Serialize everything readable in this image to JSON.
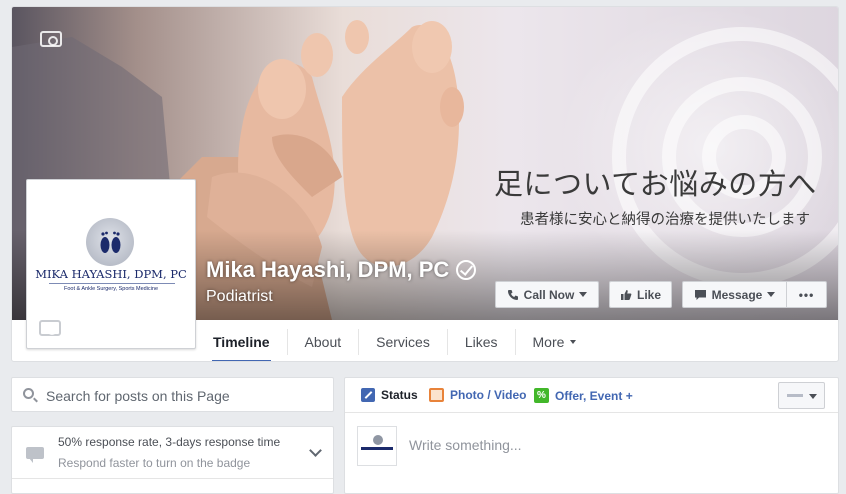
{
  "page": {
    "name": "Mika Hayashi, DPM, PC",
    "category": "Podiatrist",
    "verified": true
  },
  "cover": {
    "headline_jp": "足についてお悩みの方へ",
    "subline_jp": "患者様に安心と納得の治療を提供いたします"
  },
  "profile_logo": {
    "name": "MIKA HAYASHI, DPM, PC",
    "tagline": "Foot & Ankle Surgery, Sports Medicine"
  },
  "actions": {
    "call_now": "Call Now",
    "like": "Like",
    "message": "Message",
    "more": "•••"
  },
  "tabs": [
    {
      "label": "Timeline",
      "active": true
    },
    {
      "label": "About"
    },
    {
      "label": "Services"
    },
    {
      "label": "Likes"
    },
    {
      "label": "More"
    }
  ],
  "search": {
    "placeholder": "Search for posts on this Page"
  },
  "response": {
    "title": "50% response rate, 3-days response time",
    "subtitle": "Respond faster to turn on the badge"
  },
  "composer": {
    "tabs": [
      {
        "label": "Status",
        "icon": "pencil-icon"
      },
      {
        "label": "Photo / Video",
        "icon": "photo-icon"
      },
      {
        "label": "Offer, Event +",
        "icon": "offer-icon"
      }
    ],
    "placeholder": "Write something..."
  },
  "colors": {
    "brand_blue": "#4267b2",
    "page_bg": "#e9ebee",
    "logo_navy": "#1b2a6b"
  }
}
